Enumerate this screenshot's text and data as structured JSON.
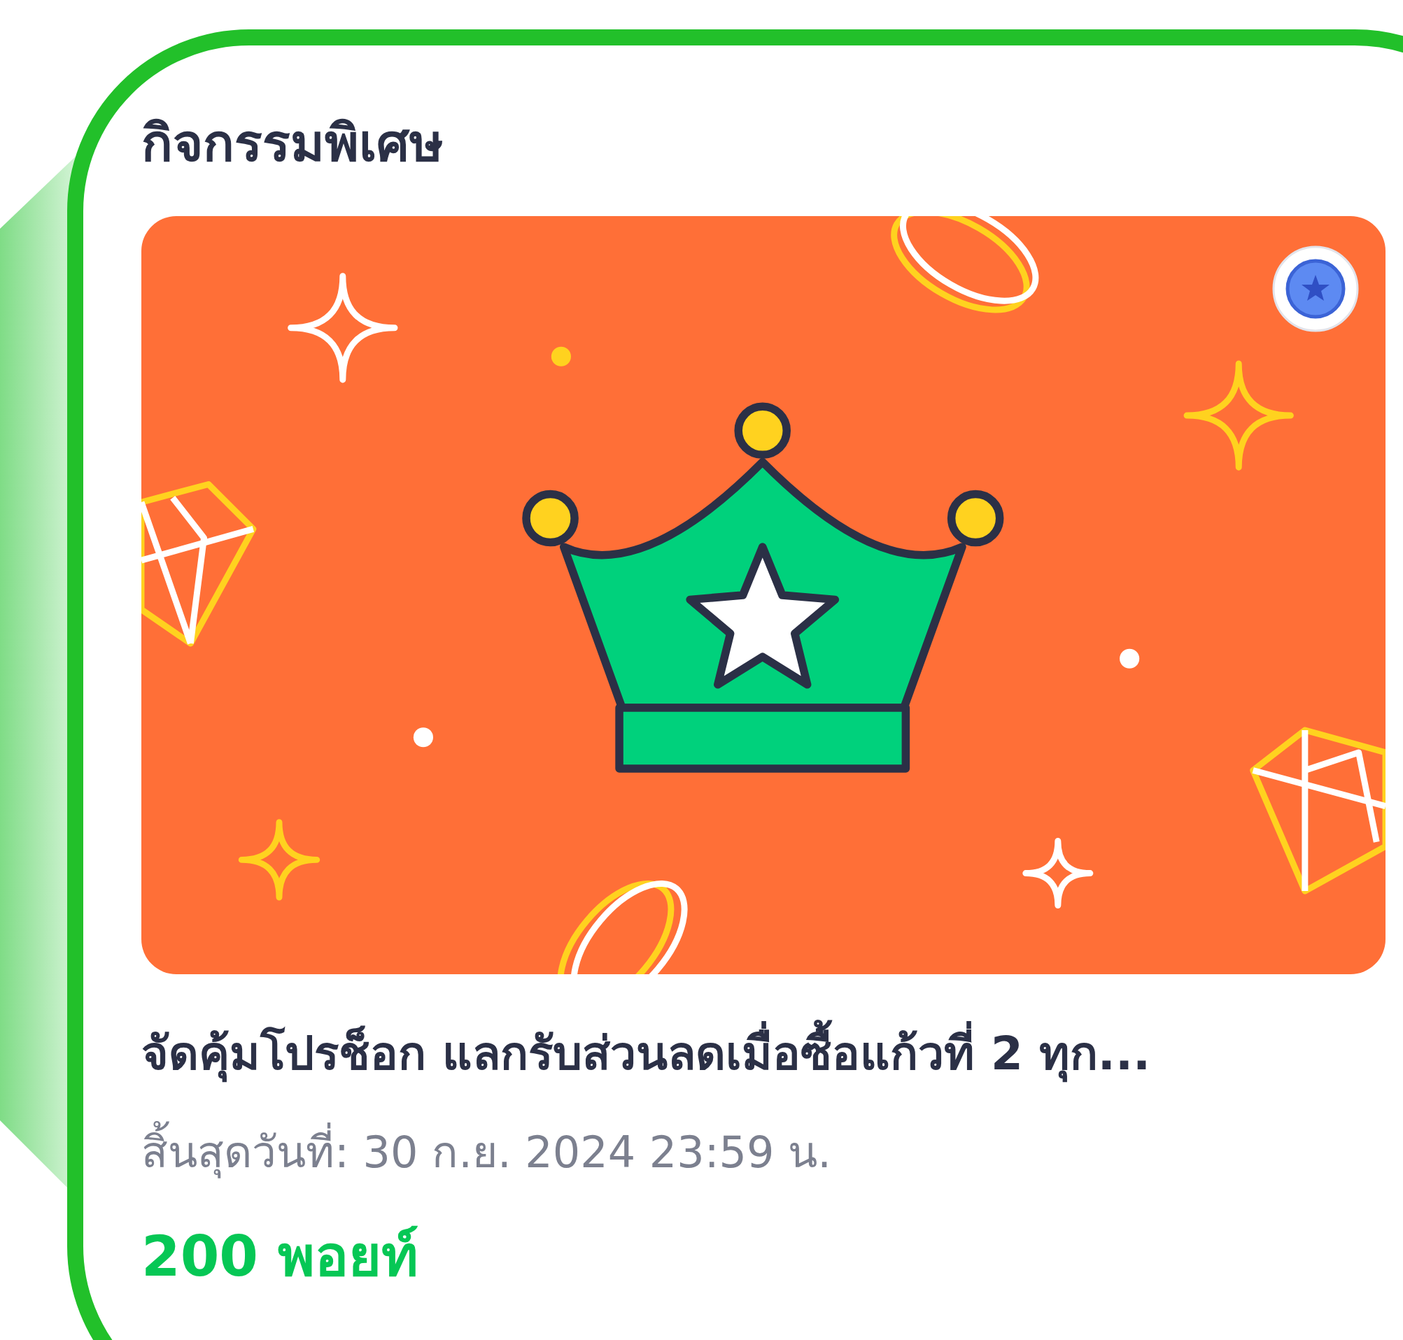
{
  "section": {
    "title": "กิจกรรมพิเศษ"
  },
  "promo": {
    "title": "จัดคุ้มโปรช็อก แลกรับส่วนลดเมื่อซื้อแก้วที่ 2 ทุก...",
    "expiry": "สิ้นสุดวันที่: 30 ก.ย. 2024 23:59 น.",
    "points": "200 พอยท์"
  }
}
